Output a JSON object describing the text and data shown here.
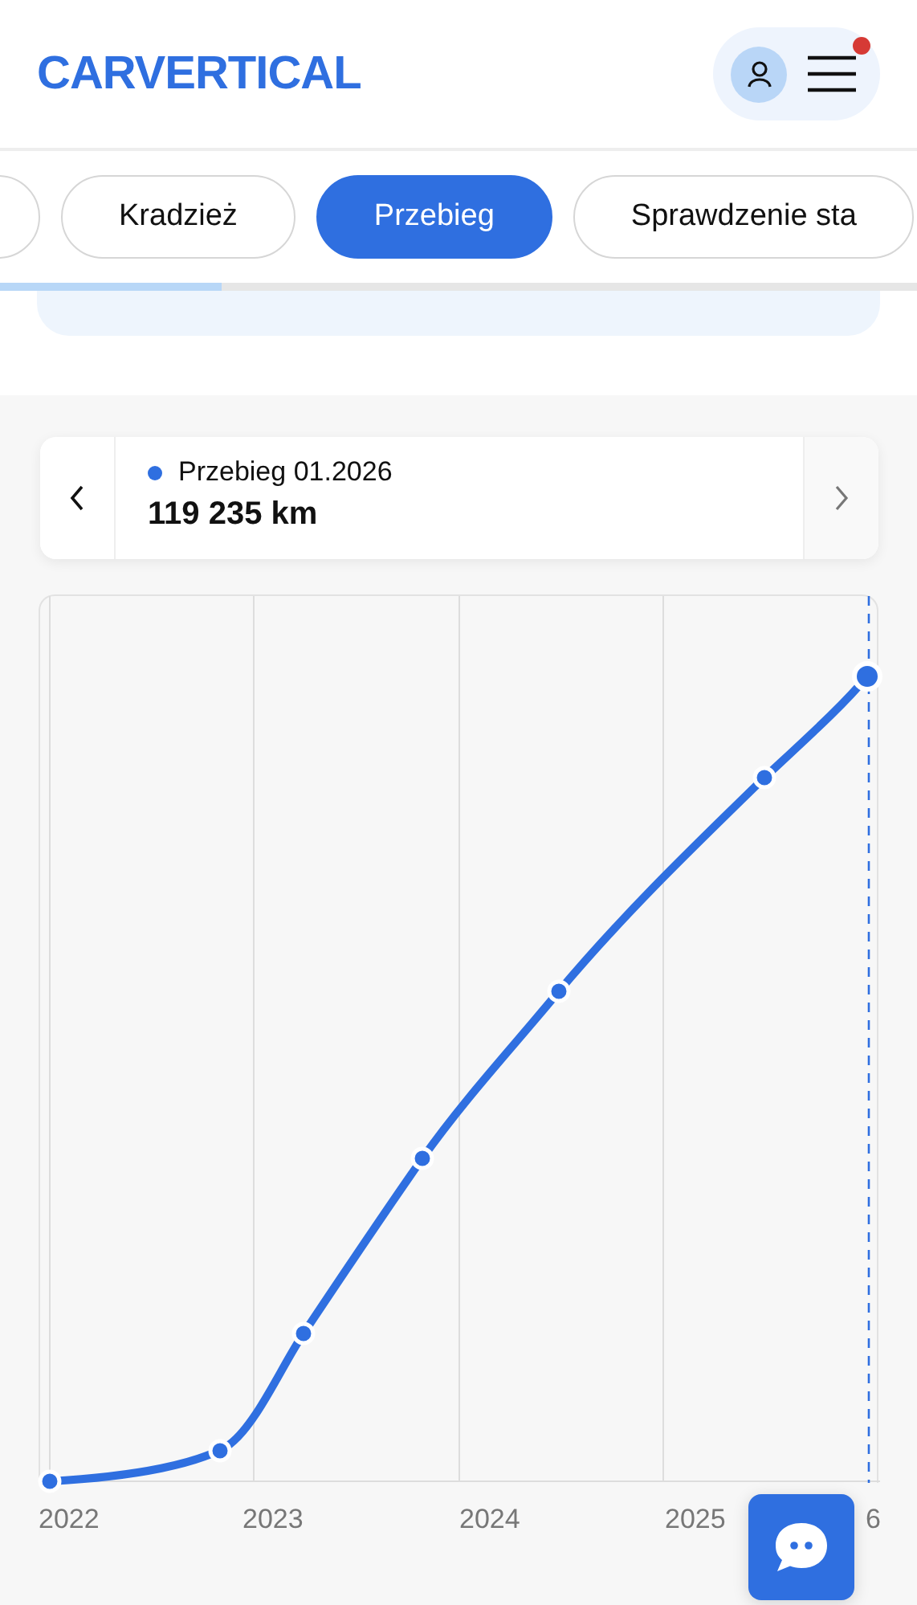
{
  "header": {
    "logo": "CARVERTICAL",
    "notification": true
  },
  "tabs": [
    {
      "selected": false
    },
    {
      "label": "Kradzież",
      "selected": false
    },
    {
      "label": "Przebieg",
      "selected": true
    },
    {
      "label": "Sprawdzenie sta",
      "selected": false
    }
  ],
  "tooltip": {
    "series": "Przebieg 01.2026",
    "value": "119 235 km",
    "color": "#2f6fe0"
  },
  "chart": {
    "x_labels": [
      "2022",
      "2023",
      "2024",
      "2025",
      "6"
    ]
  }
}
